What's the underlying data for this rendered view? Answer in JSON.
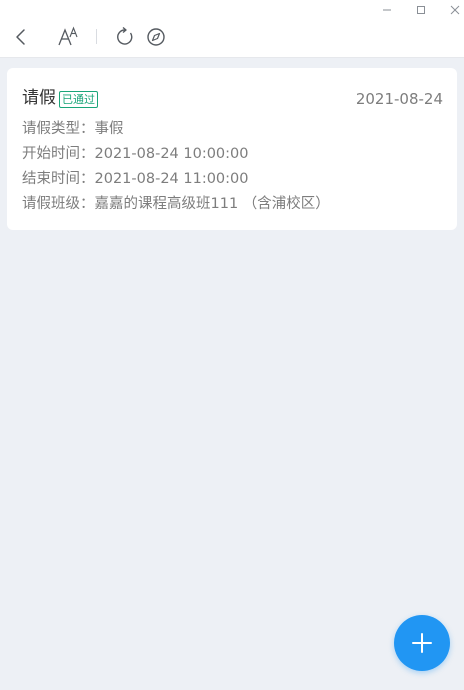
{
  "window_controls": {
    "minimize_icon": "minimize-icon",
    "maximize_icon": "maximize-icon",
    "close_icon": "close-icon"
  },
  "toolbar": {
    "back_icon": "chevron-left-icon",
    "font_icon": "font-size-icon",
    "refresh_icon": "refresh-icon",
    "compass_icon": "compass-icon"
  },
  "card": {
    "title": "请假",
    "status": "已通过",
    "date": "2021-08-24",
    "rows": [
      "请假类型：事假",
      "开始时间：2021-08-24 10:00:00",
      "结束时间：2021-08-24 11:00:00",
      "请假班级：嘉嘉的课程高级班111 （含浦校区）"
    ]
  },
  "fab": {
    "icon": "plus-icon"
  },
  "colors": {
    "accent": "#2196f3",
    "status_green": "#1aa579",
    "background": "#edf0f5"
  }
}
